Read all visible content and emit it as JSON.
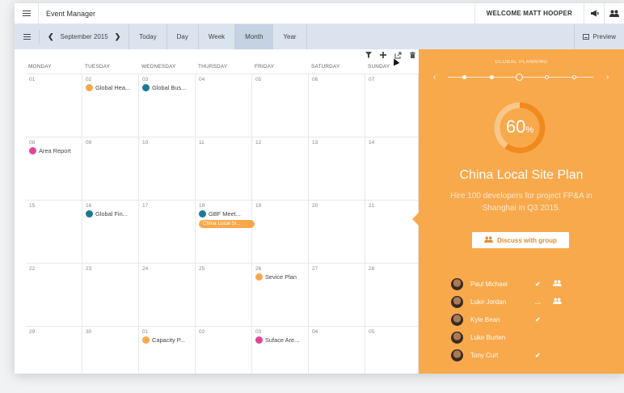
{
  "app": {
    "title": "Event Manager",
    "welcome": "WELCOME MATT HOOPER"
  },
  "toolbar": {
    "month": "September 2015",
    "views": [
      "Today",
      "Day",
      "Week",
      "Month",
      "Year"
    ],
    "active_view": "Month",
    "preview": "Preview"
  },
  "calendar": {
    "day_headers": [
      "MONDAY",
      "TUESDAY",
      "WEDNESDAY",
      "THURSDAY",
      "FRIDAY",
      "SATURDAY",
      "SUNDAY"
    ],
    "weeks": [
      {
        "days": [
          {
            "num": "01"
          },
          {
            "num": "02",
            "event": {
              "label": "Global Hea...",
              "color": "#f7a94a"
            }
          },
          {
            "num": "03",
            "event": {
              "label": "Global Bus...",
              "color": "#1a7a93"
            }
          },
          {
            "num": "04"
          },
          {
            "num": "05"
          },
          {
            "num": "06"
          },
          {
            "num": "07"
          }
        ]
      },
      {
        "days": [
          {
            "num": "08",
            "event": {
              "label": "Area Report",
              "color": "#e2449a"
            }
          },
          {
            "num": "09"
          },
          {
            "num": "10"
          },
          {
            "num": "11"
          },
          {
            "num": "12"
          },
          {
            "num": "13"
          },
          {
            "num": "14"
          }
        ]
      },
      {
        "days": [
          {
            "num": "15"
          },
          {
            "num": "16",
            "event": {
              "label": "Global Fin...",
              "color": "#1a7a93"
            }
          },
          {
            "num": "17"
          },
          {
            "num": "18",
            "event": {
              "label": "GBF Meet...",
              "color": "#1a7a93"
            },
            "bar": "China Local Si..."
          },
          {
            "num": "19"
          },
          {
            "num": "20"
          },
          {
            "num": "21"
          }
        ]
      },
      {
        "days": [
          {
            "num": "22"
          },
          {
            "num": "23"
          },
          {
            "num": "24"
          },
          {
            "num": "25"
          },
          {
            "num": "26",
            "event": {
              "label": "Sevice Plan",
              "color": "#f7a94a"
            }
          },
          {
            "num": "27"
          },
          {
            "num": "28"
          }
        ]
      },
      {
        "days": [
          {
            "num": "29"
          },
          {
            "num": "30"
          },
          {
            "num": "01",
            "event": {
              "label": "Capacity P...",
              "color": "#f7a94a"
            }
          },
          {
            "num": "02"
          },
          {
            "num": "03",
            "event": {
              "label": "Suface Are...",
              "color": "#e2449a"
            }
          },
          {
            "num": "04"
          },
          {
            "num": "05"
          }
        ]
      }
    ]
  },
  "panel": {
    "label": "GLOBAL PLANNING",
    "progress_percent": 60,
    "progress_unit": "%",
    "title": "China Local Site Plan",
    "description": "Hire 100 developers for project FP&A in Shanghai in Q3 2015.",
    "discuss_label": "Discuss with group",
    "people": [
      {
        "name": "Paul Michael",
        "status": "✔",
        "group": true
      },
      {
        "name": "Luke Jordan",
        "status": "...",
        "group": true
      },
      {
        "name": "Kyle Bean",
        "status": "✔",
        "group": false
      },
      {
        "name": "Luke Burten",
        "status": "",
        "group": false
      },
      {
        "name": "Tony Curt",
        "status": "✔",
        "group": false
      }
    ],
    "accent_color": "#f8a94c"
  }
}
